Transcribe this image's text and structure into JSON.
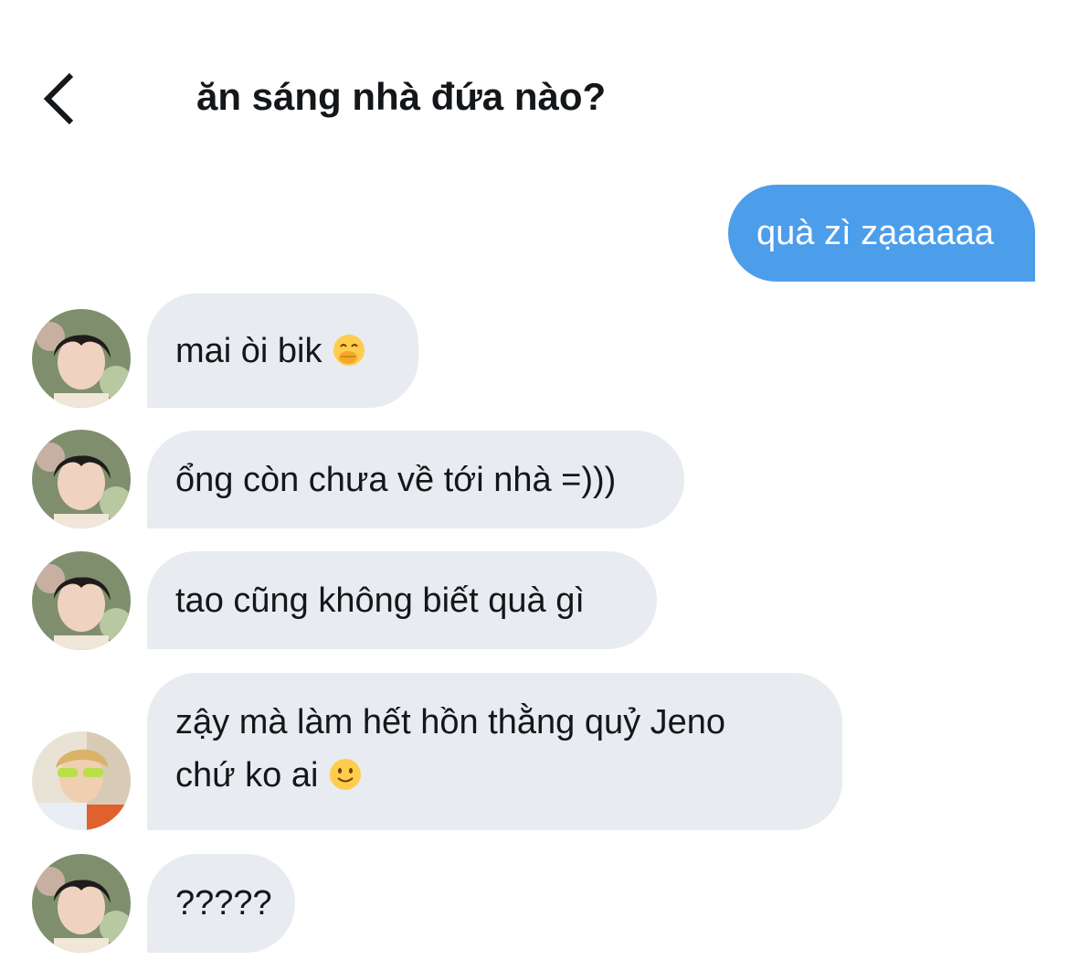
{
  "header": {
    "title": "ăn sáng nhà đứa nào?",
    "back_icon": "chevron-left-icon"
  },
  "messages": [
    {
      "direction": "outgoing",
      "text": "quà zì zạaaaaa"
    },
    {
      "direction": "incoming",
      "sender": "user-a",
      "text": "mai òi bik",
      "emoji": "face-with-hand-over-mouth"
    },
    {
      "direction": "incoming",
      "sender": "user-a",
      "text": "ổng còn chưa về tới nhà =)))"
    },
    {
      "direction": "incoming",
      "sender": "user-a",
      "text": "tao cũng không biết quà gì"
    },
    {
      "direction": "incoming",
      "sender": "user-b",
      "line1": "zậy mà làm hết hồn thằng quỷ Jeno",
      "line2": "chứ ko ai",
      "emoji": "slightly-smiling-face"
    },
    {
      "direction": "incoming",
      "sender": "user-a",
      "text": "?????"
    }
  ],
  "colors": {
    "outgoing_bubble": "#4c9eeb",
    "incoming_bubble": "#e8ebef",
    "text": "#14171a"
  }
}
